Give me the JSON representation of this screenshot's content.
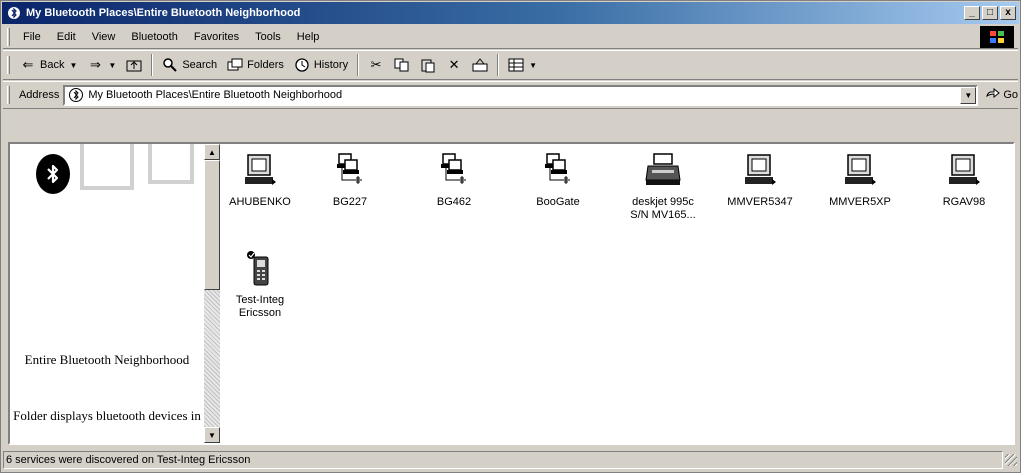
{
  "window": {
    "title": "My Bluetooth Places\\Entire Bluetooth Neighborhood",
    "controls": {
      "minimize": "_",
      "maximize": "□",
      "close": "x"
    }
  },
  "menu": {
    "items": [
      {
        "label": "File"
      },
      {
        "label": "Edit"
      },
      {
        "label": "View"
      },
      {
        "label": "Bluetooth"
      },
      {
        "label": "Favorites"
      },
      {
        "label": "Tools"
      },
      {
        "label": "Help"
      }
    ]
  },
  "toolbar": {
    "back_label": "Back",
    "search_label": "Search",
    "folders_label": "Folders",
    "history_label": "History"
  },
  "address": {
    "label": "Address",
    "value": "My Bluetooth Places\\Entire Bluetooth Neighborhood",
    "go_label": "Go"
  },
  "left_pane": {
    "title": "Entire Bluetooth Neighborhood",
    "description": "Folder displays bluetooth devices in"
  },
  "devices": [
    {
      "label": "AHUBENKO",
      "icon": "computer-icon"
    },
    {
      "label": "BG227",
      "icon": "network-icon"
    },
    {
      "label": "BG462",
      "icon": "network-icon"
    },
    {
      "label": "BooGate",
      "icon": "network-icon"
    },
    {
      "label": "deskjet 995c\nS/N MV165...",
      "icon": "printer-icon"
    },
    {
      "label": "MMVER5347",
      "icon": "computer-icon"
    },
    {
      "label": "MMVER5XP",
      "icon": "computer-icon"
    },
    {
      "label": "RGAV98",
      "icon": "computer-icon"
    },
    {
      "label": "Test-Integ\nEricsson",
      "icon": "phone-icon"
    }
  ],
  "status": {
    "text": "6 services were discovered on Test-Integ Ericsson"
  }
}
